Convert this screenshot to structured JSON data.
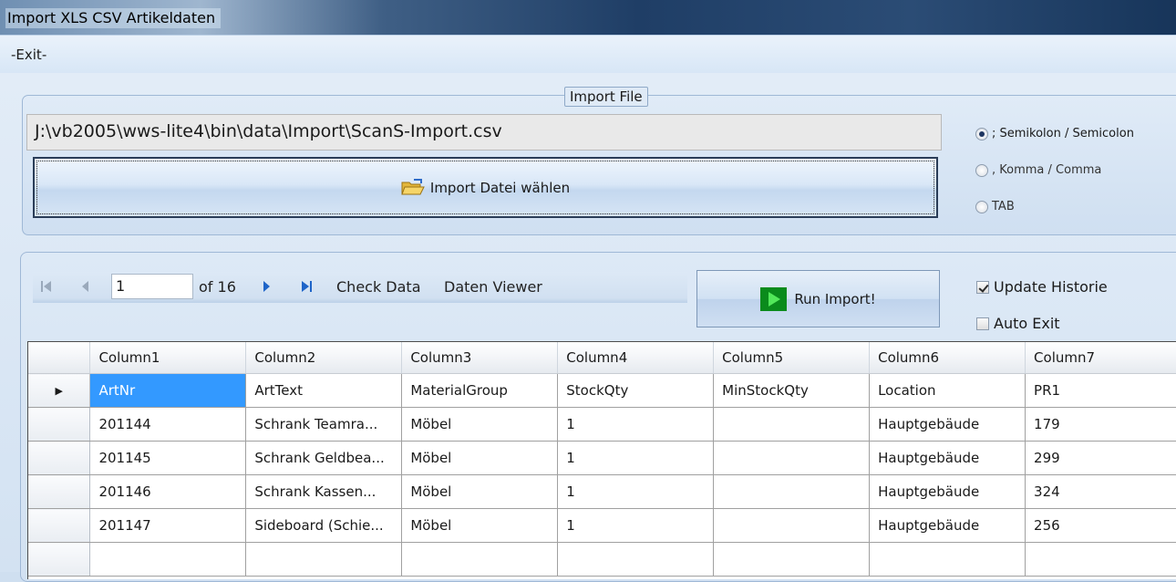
{
  "window": {
    "title": "Import XLS CSV Artikeldaten"
  },
  "menu": {
    "exit_label": "-Exit-"
  },
  "import_group": {
    "legend": "Import File",
    "file_path": "J:\\vb2005\\wws-lite4\\bin\\data\\Import\\ScanS-Import.csv",
    "choose_button_label": "Import Datei wählen",
    "separator_options": [
      {
        "label": "; Semikolon / Semicolon",
        "checked": true
      },
      {
        "label": ", Komma / Comma",
        "checked": false
      },
      {
        "label": "TAB",
        "checked": false
      }
    ]
  },
  "navigator": {
    "position": "1",
    "of_label": "of 16",
    "check_data_label": "Check Data",
    "daten_viewer_label": "Daten Viewer"
  },
  "actions": {
    "run_import_label": "Run Import!",
    "update_historie_label": "Update Historie",
    "update_historie_checked": true,
    "auto_exit_label": "Auto Exit",
    "auto_exit_checked": false
  },
  "grid": {
    "columns": [
      "Column1",
      "Column2",
      "Column3",
      "Column4",
      "Column5",
      "Column6",
      "Column7"
    ],
    "rows": [
      [
        "ArtNr",
        "ArtText",
        "MaterialGroup",
        "StockQty",
        "MinStockQty",
        "Location",
        "PR1"
      ],
      [
        "201144",
        "Schrank Teamra...",
        "Möbel",
        "1",
        "",
        "Hauptgebäude",
        "179"
      ],
      [
        "201145",
        "Schrank Geldbea...",
        "Möbel",
        "1",
        "",
        "Hauptgebäude",
        "299"
      ],
      [
        "201146",
        "Schrank Kassen...",
        "Möbel",
        "1",
        "",
        "Hauptgebäude",
        "324"
      ],
      [
        "201147",
        "Sideboard (Schie...",
        "Möbel",
        "1",
        "",
        "Hauptgebäude",
        "256"
      ],
      [
        "",
        "",
        "",
        "",
        "",
        "",
        ""
      ]
    ],
    "current_row_marker": "▶"
  }
}
